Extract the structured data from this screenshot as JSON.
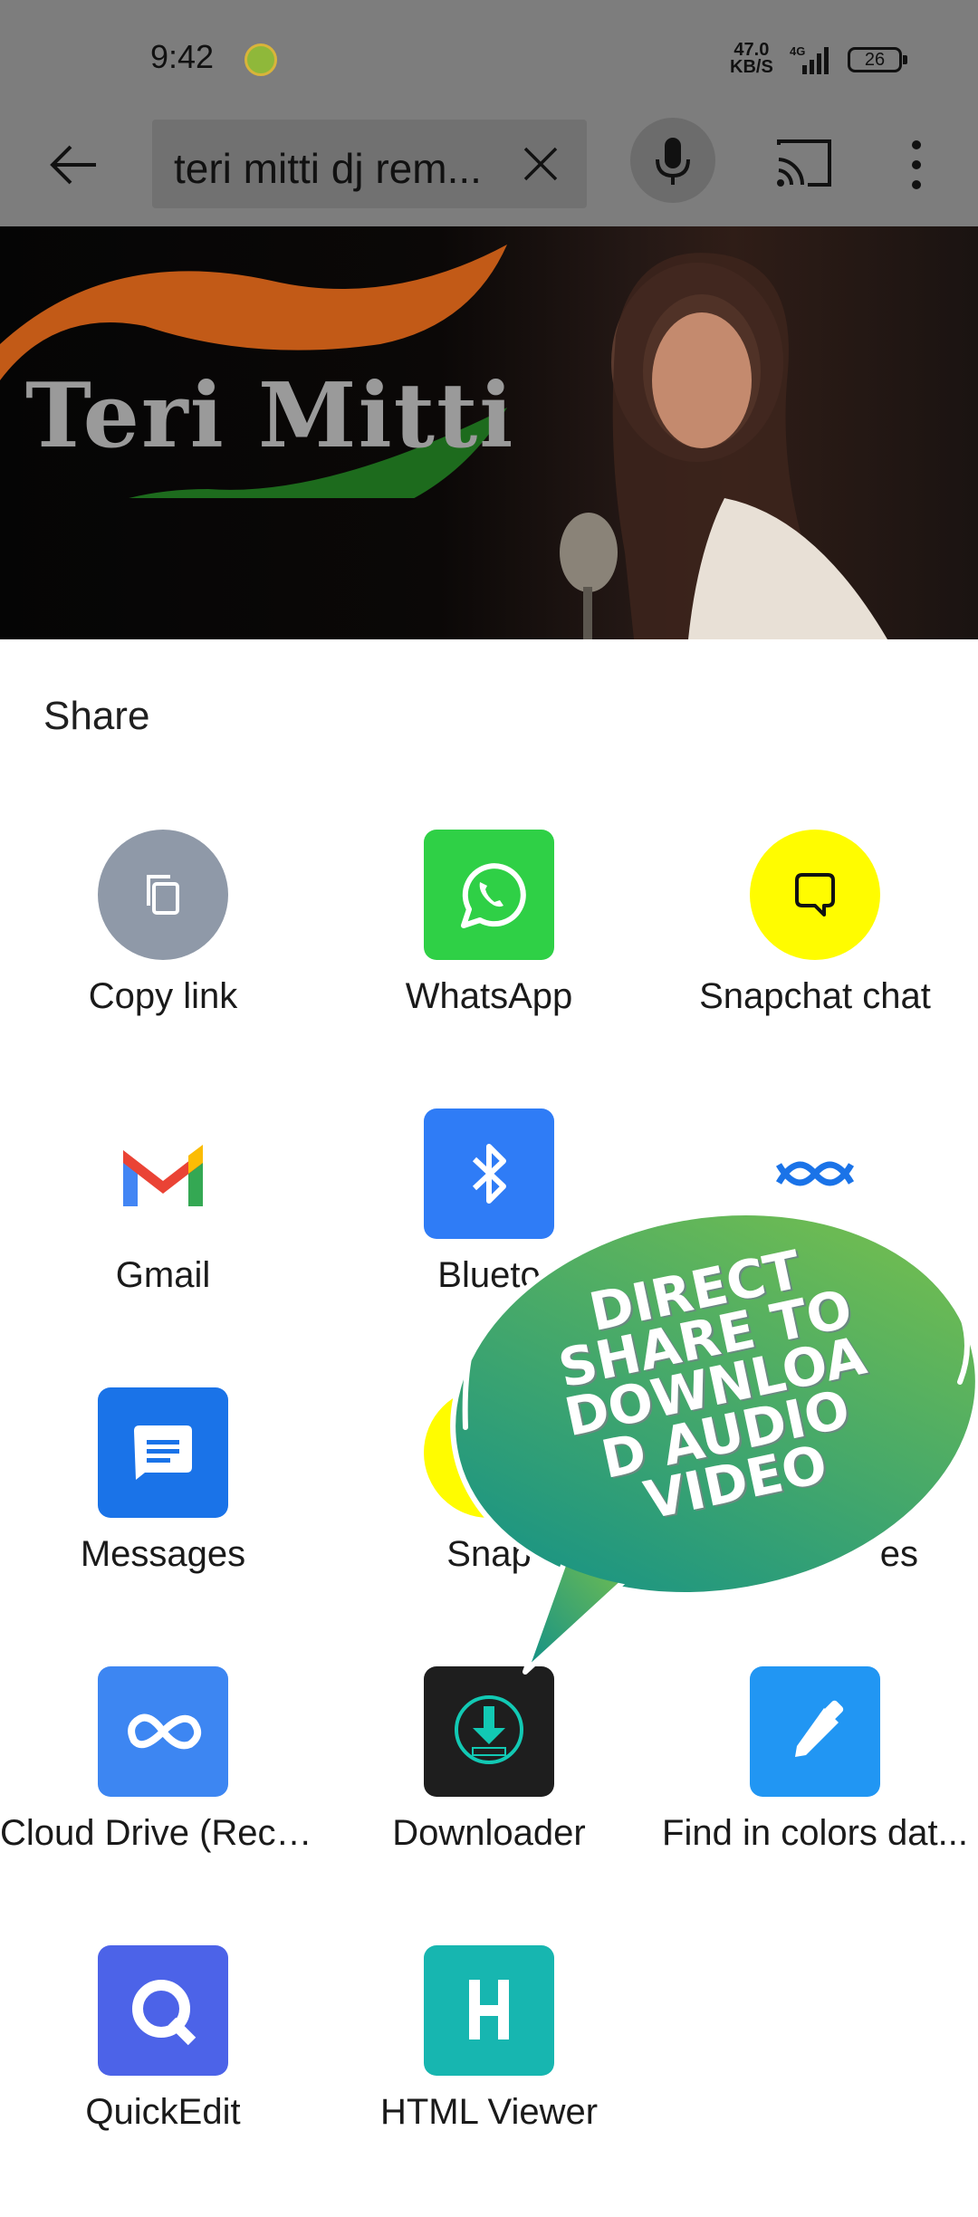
{
  "status_bar": {
    "time": "9:42",
    "net_speed_value": "47.0",
    "net_speed_unit": "KB/S",
    "network": "4G",
    "battery": "26"
  },
  "app_bar": {
    "search_text": "teri mitti dj rem..."
  },
  "banner": {
    "title": "Teri Mitti"
  },
  "share_sheet": {
    "title": "Share",
    "targets": [
      {
        "label": "Copy link",
        "icon": "copy-icon",
        "bg": "#8f99a8"
      },
      {
        "label": "WhatsApp",
        "icon": "whatsapp-icon",
        "bg": "#2fd046"
      },
      {
        "label": "Snapchat chat",
        "icon": "snapchat-chat-icon",
        "bg": "#fffc00"
      },
      {
        "label": "Gmail",
        "icon": "gmail-icon",
        "bg": "#ffffff"
      },
      {
        "label": "Blueto",
        "icon": "bluetooth-icon",
        "bg": "#2f7cf6"
      },
      {
        "label": "",
        "icon": "nearby-share-icon",
        "bg": "#ffffff"
      },
      {
        "label": "Messages",
        "icon": "messages-icon",
        "bg": "#1a73e8"
      },
      {
        "label": "Snap",
        "icon": "snapchat-icon",
        "bg": "#fffc00"
      },
      {
        "label": "es",
        "icon": "hidden-app-icon",
        "bg": "#ffffff"
      },
      {
        "label": "Cloud Drive (Reco...",
        "icon": "cloud-drive-icon",
        "bg": "#3d86f2"
      },
      {
        "label": "Downloader",
        "icon": "downloader-icon",
        "bg": "#1e1e1e"
      },
      {
        "label": "Find in colors dat...",
        "icon": "color-picker-icon",
        "bg": "#2196f3"
      },
      {
        "label": "QuickEdit",
        "icon": "quickedit-icon",
        "bg": "#4c63e8"
      },
      {
        "label": "HTML Viewer",
        "icon": "html-viewer-icon",
        "bg": "#17b6b0"
      }
    ]
  },
  "overlay": {
    "lines": [
      "DIRECT",
      "SHARE TO",
      "DOWNLOA",
      "D AUDIO",
      "VIDEO"
    ]
  },
  "colors": {
    "scrim": "#7d7d7d",
    "bubble_start": "#7cc24a",
    "bubble_end": "#0f8f8a"
  }
}
